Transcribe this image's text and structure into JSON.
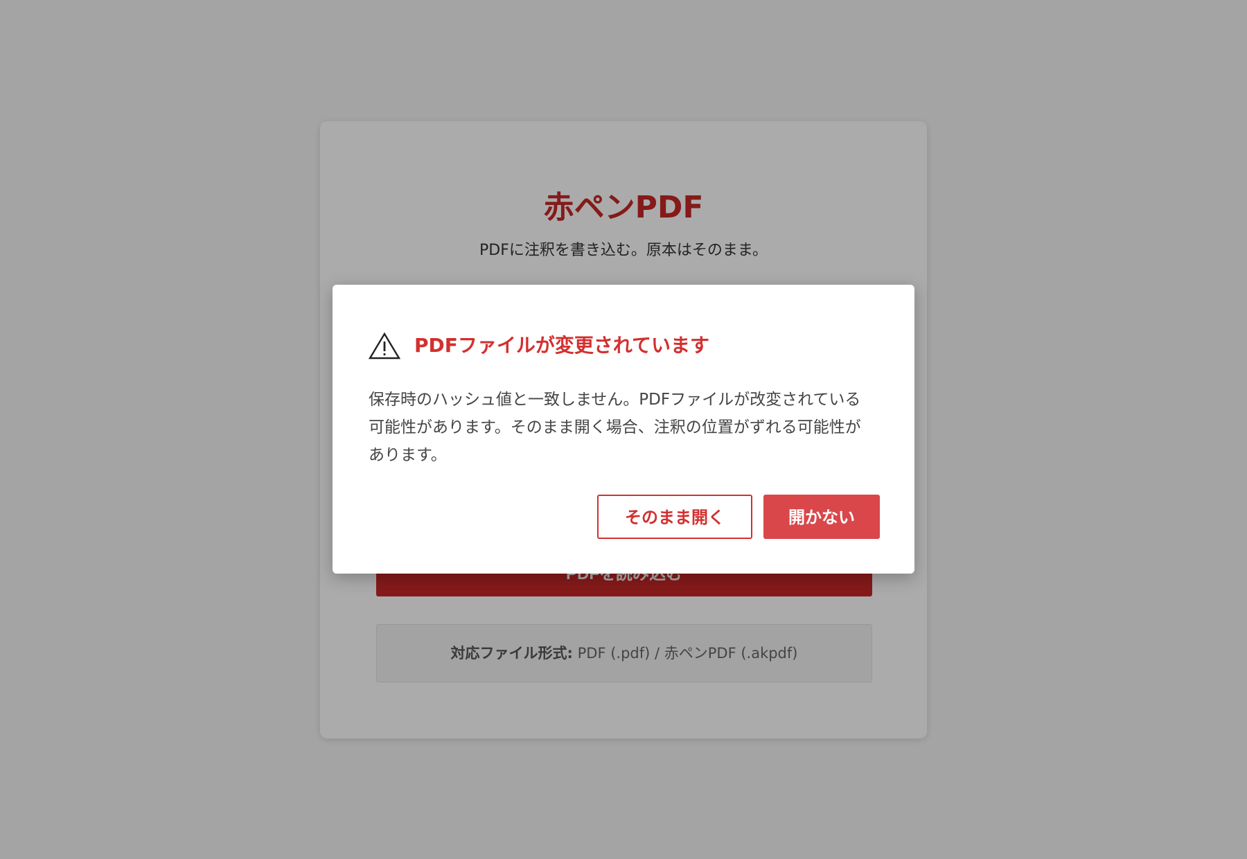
{
  "app": {
    "title": "赤ペンPDF",
    "tagline": "PDFに注釈を書き込む。原本はそのまま。",
    "load_button": "PDFを読み込む",
    "formats_label": "対応ファイル形式:",
    "formats_value": "PDF (.pdf) / 赤ペンPDF (.akpdf)"
  },
  "dialog": {
    "icon": "warning-triangle-icon",
    "title": "PDFファイルが変更されています",
    "message": "保存時のハッシュ値と一致しません。PDFファイルが改変されている可能性があります。そのまま開く場合、注釈の位置がずれる可能性があります。",
    "open_anyway_label": "そのまま開く",
    "cancel_label": "開かない"
  },
  "colors": {
    "brand_red": "#c62828",
    "dialog_title_red": "#d32f2f",
    "primary_button": "#d9474a"
  }
}
